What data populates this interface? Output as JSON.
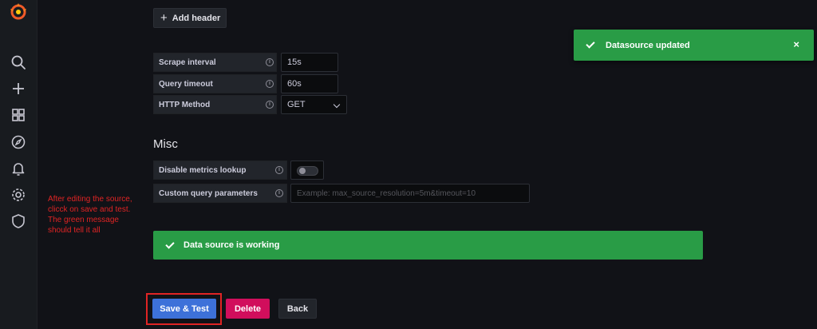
{
  "sidebar": {
    "logo_icon": "grafana-logo-icon",
    "items": [
      {
        "name": "search",
        "icon": "search-icon"
      },
      {
        "name": "create",
        "icon": "plus-icon"
      },
      {
        "name": "dashboards",
        "icon": "dashboards-grid-icon"
      },
      {
        "name": "explore",
        "icon": "compass-icon"
      },
      {
        "name": "alerting",
        "icon": "bell-icon"
      },
      {
        "name": "configuration",
        "icon": "gear-icon"
      },
      {
        "name": "server-admin",
        "icon": "shield-icon"
      }
    ]
  },
  "headers": {
    "add_header_label": "Add header"
  },
  "http_settings": {
    "scrape_interval": {
      "label": "Scrape interval",
      "value": "15s"
    },
    "query_timeout": {
      "label": "Query timeout",
      "value": "60s"
    },
    "http_method": {
      "label": "HTTP Method",
      "value": "GET"
    }
  },
  "misc": {
    "title": "Misc",
    "disable_metrics_lookup": {
      "label": "Disable metrics lookup",
      "enabled": false
    },
    "custom_query_parameters": {
      "label": "Custom query parameters",
      "value": "",
      "placeholder": "Example: max_source_resolution=5m&timeout=10"
    }
  },
  "status": {
    "working_message": "Data source is working"
  },
  "toast": {
    "message": "Datasource updated",
    "close_glyph": "×"
  },
  "annotation": {
    "text": "After editing the source, clicck on save and test. The green message should tell it all"
  },
  "actions": {
    "save_label": "Save & Test",
    "delete_label": "Delete",
    "back_label": "Back"
  },
  "colors": {
    "background": "#111217",
    "success": "#299c46",
    "primary": "#3d71d9",
    "destructive": "#d10e5c",
    "annotation_red": "#e02424"
  }
}
